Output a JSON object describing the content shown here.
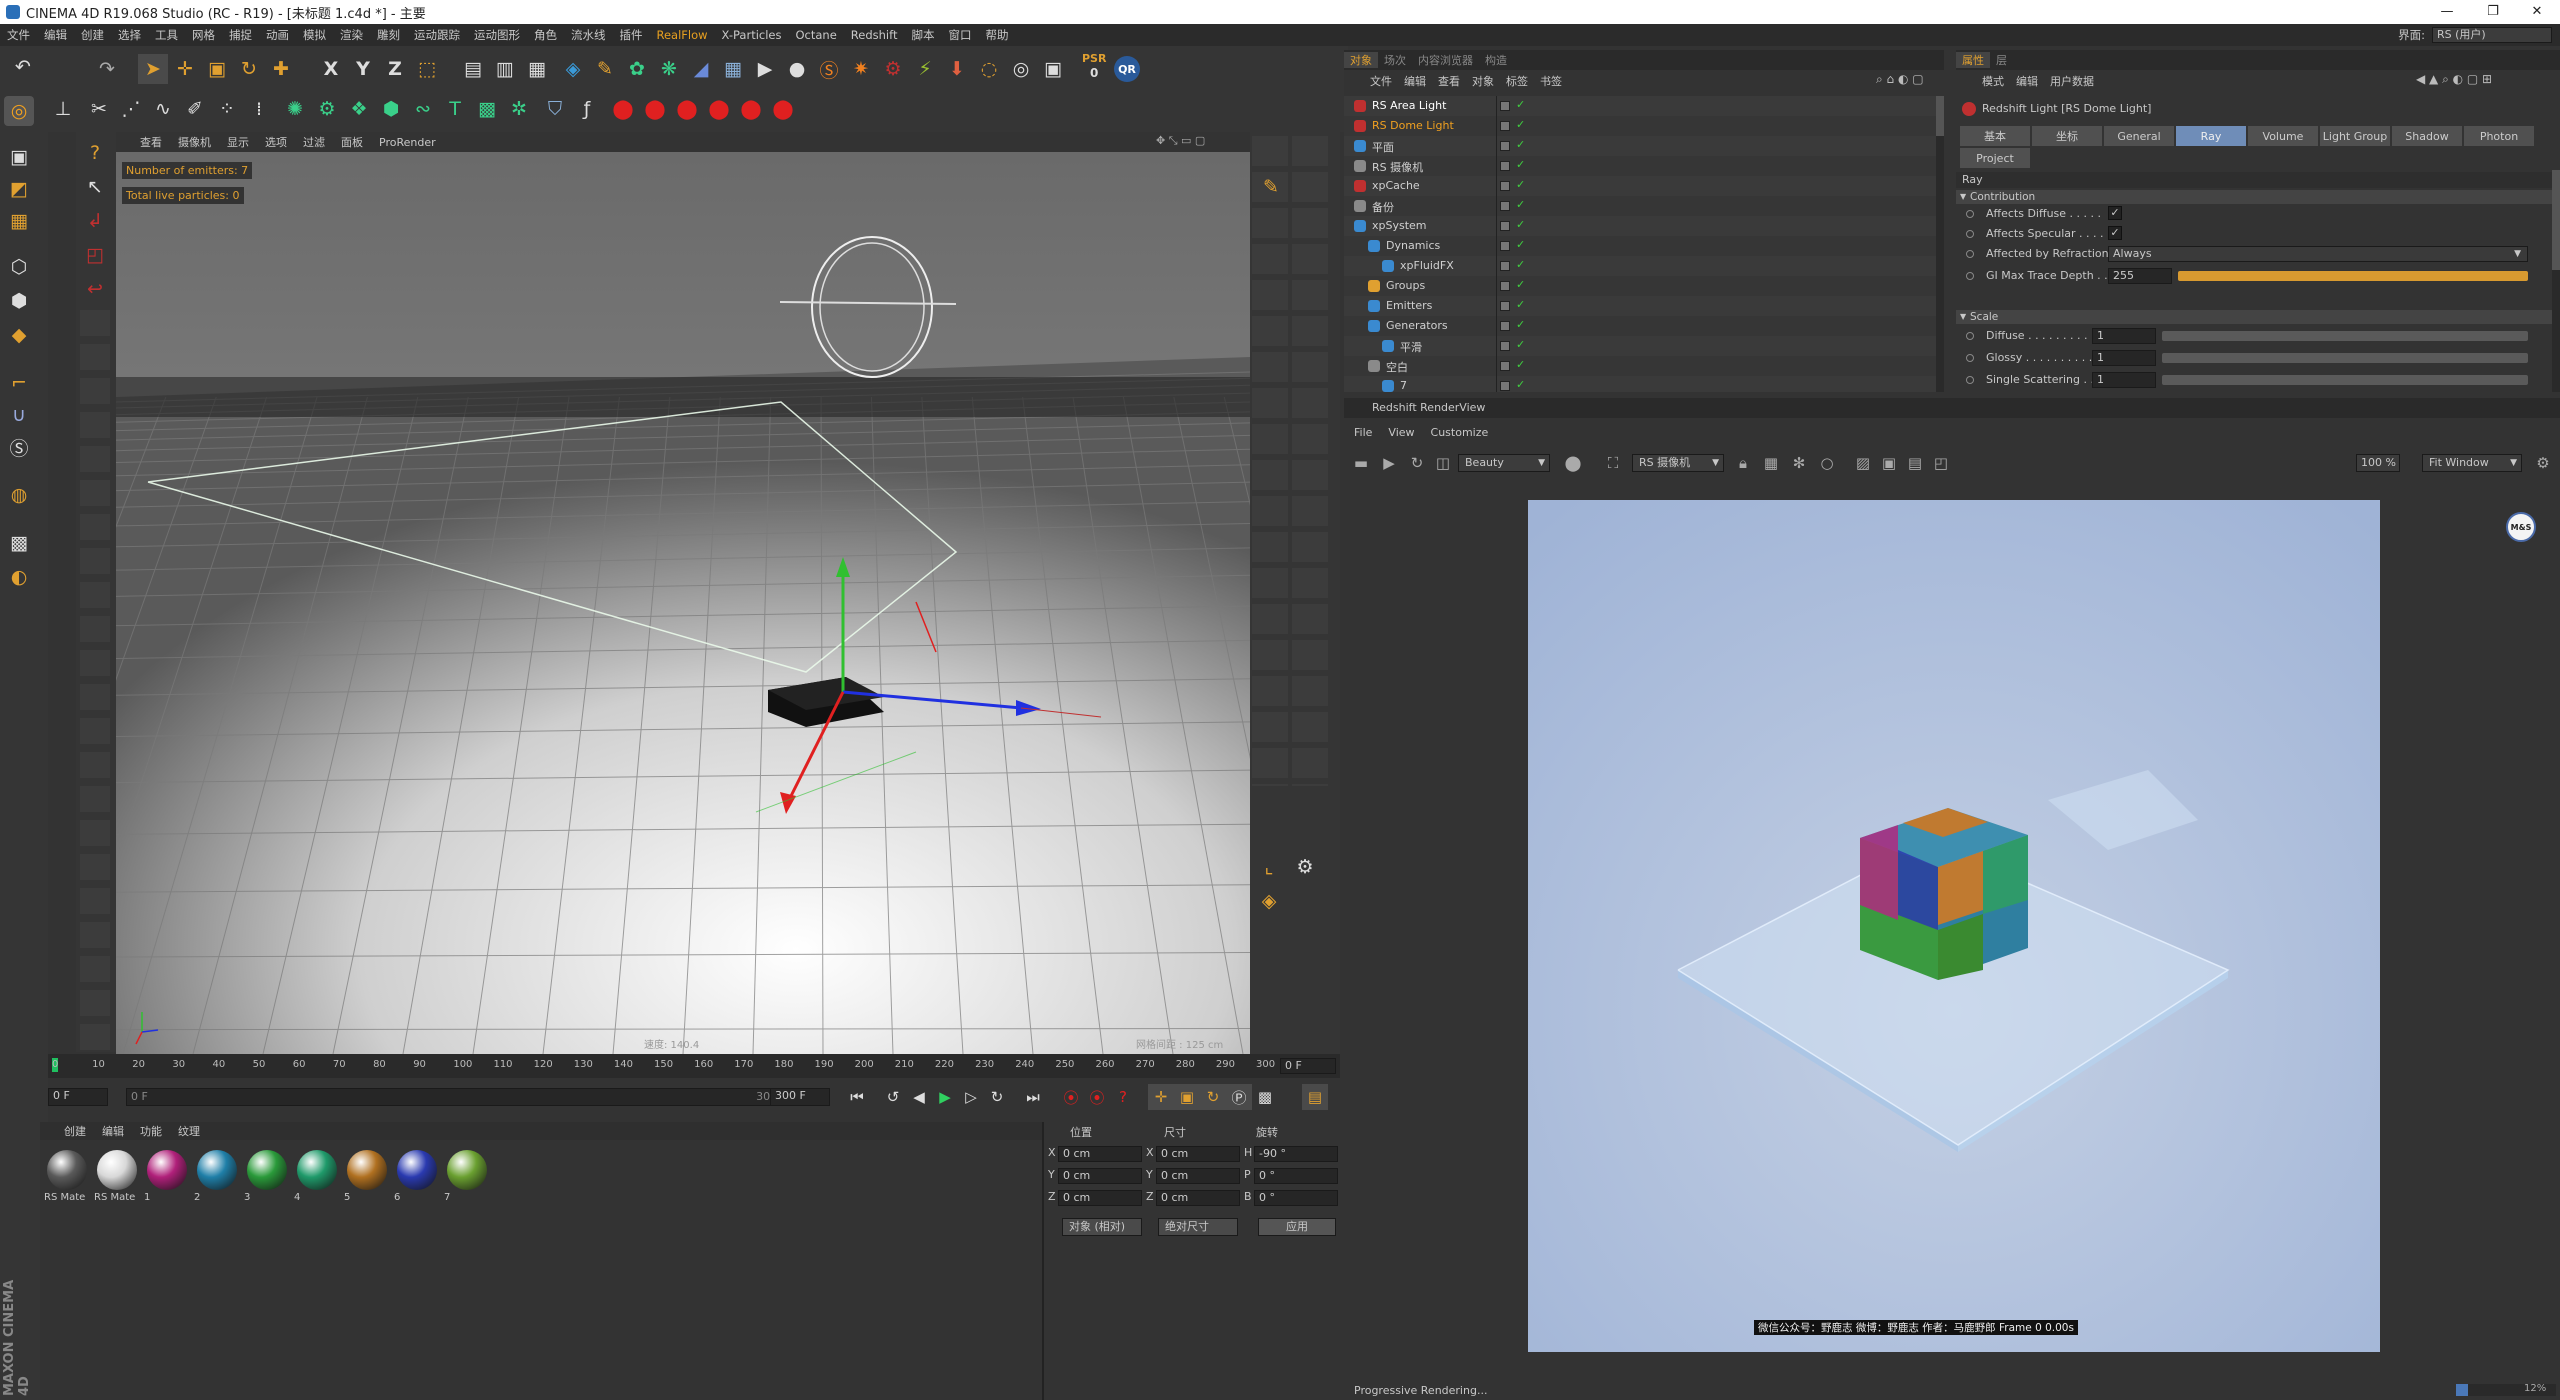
{
  "window": {
    "title": "CINEMA 4D R19.068 Studio (RC - R19) - [未标题 1.c4d *] - 主要",
    "minimize": "—",
    "maximize": "❐",
    "close": "✕"
  },
  "menu": {
    "items": [
      "文件",
      "编辑",
      "创建",
      "选择",
      "工具",
      "网格",
      "捕捉",
      "动画",
      "模拟",
      "渲染",
      "雕刻",
      "运动跟踪",
      "运动图形",
      "角色",
      "流水线",
      "插件",
      "RealFlow",
      "X-Particles",
      "Octane",
      "Redshift",
      "脚本",
      "窗口",
      "帮助"
    ],
    "layout_label": "界面:",
    "layout_value": "RS (用户)"
  },
  "toolbar": {
    "axis_x": "X",
    "axis_y": "Y",
    "axis_z": "Z",
    "psr_label": "PSR",
    "psr_value": "0",
    "qr_label": "QR"
  },
  "viewport": {
    "menu": [
      "查看",
      "摄像机",
      "显示",
      "选项",
      "过滤",
      "面板",
      "ProRender"
    ],
    "hud_emitters": "Number of emitters: 7",
    "hud_particles": "Total live particles: 0",
    "speed_label": "速度: 140.4",
    "grid_label": "网格间距 : 125 cm"
  },
  "timeline": {
    "ticks": [
      "0",
      "10",
      "20",
      "30",
      "40",
      "50",
      "60",
      "70",
      "80",
      "90",
      "100",
      "110",
      "120",
      "130",
      "140",
      "150",
      "160",
      "170",
      "180",
      "190",
      "200",
      "210",
      "220",
      "230",
      "240",
      "250",
      "260",
      "270",
      "280",
      "290",
      "300"
    ],
    "current_frame": "0 F",
    "start_frame": "0 F",
    "scrub_start": "0 F",
    "scrub_end": "300 F",
    "end_frame": "300 F",
    "end_frame2": "300 F"
  },
  "materials": {
    "menu": [
      "创建",
      "编辑",
      "功能",
      "纹理"
    ],
    "items": [
      {
        "label": "RS Mate",
        "color": "#5a5a5a"
      },
      {
        "label": "RS Mate",
        "color": "#d8d8d8"
      },
      {
        "label": "1",
        "color": "#b0207a"
      },
      {
        "label": "2",
        "color": "#1f7fa8"
      },
      {
        "label": "3",
        "color": "#2a9a3a"
      },
      {
        "label": "4",
        "color": "#1f9a6a"
      },
      {
        "label": "5",
        "color": "#b07020"
      },
      {
        "label": "6",
        "color": "#2a3ab0"
      },
      {
        "label": "7",
        "color": "#6aa030"
      }
    ]
  },
  "coords": {
    "headers": [
      "位置",
      "尺寸",
      "旋转"
    ],
    "rows": [
      {
        "axis": "X",
        "pos": "0 cm",
        "size_axis": "X",
        "size": "0 cm",
        "rot_axis": "H",
        "rot": "-90 °"
      },
      {
        "axis": "Y",
        "pos": "0 cm",
        "size_axis": "Y",
        "size": "0 cm",
        "rot_axis": "P",
        "rot": "0 °"
      },
      {
        "axis": "Z",
        "pos": "0 cm",
        "size_axis": "Z",
        "size": "0 cm",
        "rot_axis": "B",
        "rot": "0 °"
      }
    ],
    "mode_select": "对象 (相对)",
    "size_select": "绝对尺寸",
    "apply_label": "应用"
  },
  "object_manager": {
    "tabs": [
      "对象",
      "场次",
      "内容浏览器",
      "构造"
    ],
    "menu": [
      "文件",
      "编辑",
      "查看",
      "对象",
      "标签",
      "书签"
    ],
    "items": [
      {
        "name": "RS Area Light",
        "indent": 0,
        "color": "#ffffff",
        "icon": "#c03030"
      },
      {
        "name": "RS Dome Light",
        "indent": 0,
        "color": "#f0a020",
        "icon": "#c03030"
      },
      {
        "name": "平面",
        "indent": 0,
        "color": "#d0d0d0",
        "icon": "#3a8ad0"
      },
      {
        "name": "RS 摄像机",
        "indent": 0,
        "color": "#d0d0d0",
        "icon": "#8a8a8a"
      },
      {
        "name": "xpCache",
        "indent": 0,
        "color": "#d0d0d0",
        "icon": "#c03030"
      },
      {
        "name": "备份",
        "indent": 0,
        "color": "#d0d0d0",
        "icon": "#8a8a8a"
      },
      {
        "name": "xpSystem",
        "indent": 0,
        "color": "#d0d0d0",
        "icon": "#3a8ad0"
      },
      {
        "name": "Dynamics",
        "indent": 1,
        "color": "#d0d0d0",
        "icon": "#3a8ad0"
      },
      {
        "name": "xpFluidFX",
        "indent": 2,
        "color": "#d0d0d0",
        "icon": "#3a8ad0"
      },
      {
        "name": "Groups",
        "indent": 1,
        "color": "#d0d0d0",
        "icon": "#e0a030"
      },
      {
        "name": "Emitters",
        "indent": 1,
        "color": "#d0d0d0",
        "icon": "#3a8ad0"
      },
      {
        "name": "Generators",
        "indent": 1,
        "color": "#d0d0d0",
        "icon": "#3a8ad0"
      },
      {
        "name": "平滑",
        "indent": 2,
        "color": "#d0d0d0",
        "icon": "#3a8ad0"
      },
      {
        "name": "空白",
        "indent": 1,
        "color": "#d0d0d0",
        "icon": "#8a8a8a"
      },
      {
        "name": "7",
        "indent": 2,
        "color": "#d0d0d0",
        "icon": "#3a8ad0"
      }
    ]
  },
  "attributes": {
    "tabs": [
      "属性",
      "层"
    ],
    "menu": [
      "模式",
      "编辑",
      "用户数据"
    ],
    "object_title": "Redshift Light [RS Dome Light]",
    "tab_row1": [
      "基本",
      "坐标",
      "General",
      "Ray",
      "Volume",
      "Light Group",
      "Shadow",
      "Photon"
    ],
    "tab_row2": [
      "Project"
    ],
    "active_tab": "Ray",
    "section": "Ray",
    "group_contribution": "Contribution",
    "affects_diffuse": "Affects Diffuse . . . . .",
    "affects_specular": "Affects Specular . . . .",
    "affected_refraction": "Affected by Refraction",
    "refraction_value": "Always",
    "gi_trace_label": "GI Max Trace Depth . .",
    "gi_trace_value": "255",
    "check_mark": "✓",
    "group_scale": "Scale",
    "diffuse_label": "Diffuse . . . . . . . . . .",
    "diffuse_value": "1",
    "glossy_label": "Glossy . . . . . . . . . .",
    "glossy_value": "1",
    "single_scatter_label": "Single Scattering . .",
    "single_scatter_value": "1"
  },
  "renderview": {
    "title": "Redshift RenderView",
    "menu": [
      "File",
      "View",
      "Customize"
    ],
    "aov": "Beauty",
    "camera": "RS 摄像机",
    "zoom": "100 %",
    "fit": "Fit Window",
    "watermark": "微信公众号：野鹿志  微博：野鹿志  作者：马鹿野郎  Frame  0  0.00s",
    "logo": "M&S",
    "status": "Progressive Rendering...",
    "progress": "12%",
    "progress_fraction": 0.12
  },
  "sidebar": {
    "brand": "MAXON CINEMA 4D"
  }
}
